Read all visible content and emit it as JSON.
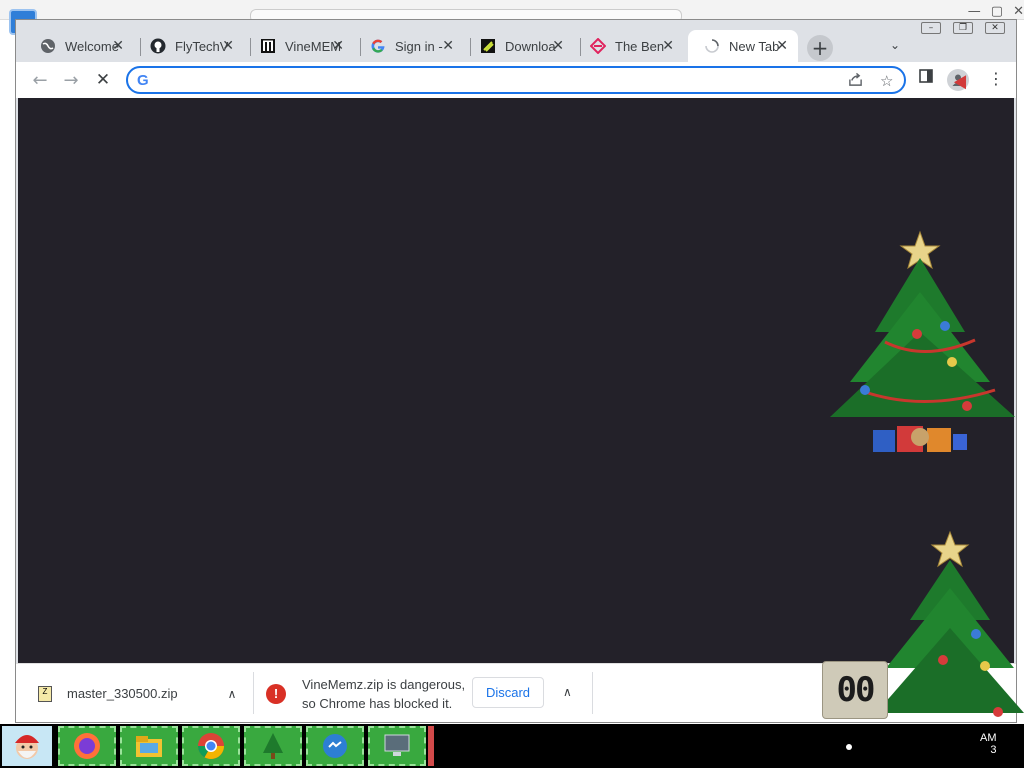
{
  "browser": {
    "tabs": [
      {
        "title": "Welcome",
        "favicon": "globe-icon",
        "active": false
      },
      {
        "title": "FlyTechV",
        "favicon": "github-icon",
        "active": false
      },
      {
        "title": "VineMEM",
        "favicon": "vinememz-icon",
        "active": false
      },
      {
        "title": "Sign in -",
        "favicon": "google-icon",
        "active": false
      },
      {
        "title": "Downloa",
        "favicon": "download-site-icon",
        "active": false
      },
      {
        "title": "The Ben",
        "favicon": "diamond-icon",
        "active": false
      },
      {
        "title": "New Tab",
        "favicon": "loading-spinner-icon",
        "active": true
      }
    ],
    "new_tab_symbol": "+",
    "tab_search_symbol": "⌄",
    "close_symbol": "✕",
    "omnibox": {
      "value": "",
      "placeholder": "",
      "google_letter": "G"
    },
    "back_symbol": "←",
    "forward_symbol": "→",
    "stop_symbol": "✕",
    "content_color": "#232129"
  },
  "download_bar": {
    "items": [
      {
        "filename": "master_330500.zip",
        "expand_symbol": "∧"
      }
    ],
    "warning": {
      "line1": "VineMemz.zip is dangerous,",
      "line2": "so Chrome has blocked it.",
      "discard_label": "Discard",
      "expand_symbol": "∧"
    }
  },
  "desktop_overlay": {
    "clock_widget_text": "00",
    "tray_time_line1": "AM",
    "tray_time_line2": "3"
  },
  "colors": {
    "accent": "#1a73e8",
    "danger": "#d93025",
    "taskbar_app": "#39a93f"
  }
}
